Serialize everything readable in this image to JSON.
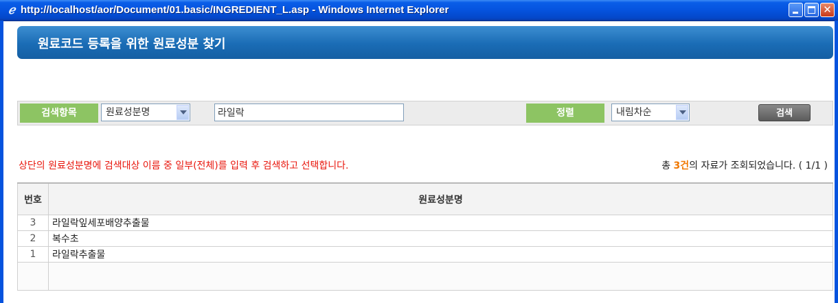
{
  "window": {
    "title": "http://localhost/aor/Document/01.basic/INGREDIENT_L.asp - Windows Internet Explorer",
    "icon": "ie-icon",
    "controls": [
      "minimize-icon",
      "maximize-icon",
      "close-icon"
    ]
  },
  "header": {
    "title": "원료코드 등록을 위한 원료성분 찾기"
  },
  "search": {
    "label": "검색항목",
    "field_selected": "원료성분명",
    "keyword_value": "라일락",
    "sort_label": "정렬",
    "sort_selected": "내림차순",
    "button_label": "검색"
  },
  "info": {
    "instruction": "상단의 원료성분명에 검색대상 이름 중 일부(전체)를 입력 후 검색하고 선택합니다.",
    "count_prefix": "총 ",
    "count_value": "3건",
    "count_suffix": "의 자료가 조회되었습니다. ( 1/1 )"
  },
  "table": {
    "columns": [
      "번호",
      "원료성분명"
    ],
    "rows": [
      {
        "no": "3",
        "name": "라일락잎세포배양추출물"
      },
      {
        "no": "2",
        "name": "복수초"
      },
      {
        "no": "1",
        "name": "라일락추출물"
      }
    ]
  },
  "colors": {
    "title_bar": "#0553de",
    "banner": "#1a6cb5",
    "label_green": "#8dc463",
    "instruction_red": "#e8150b",
    "count_orange": "#f07800"
  }
}
